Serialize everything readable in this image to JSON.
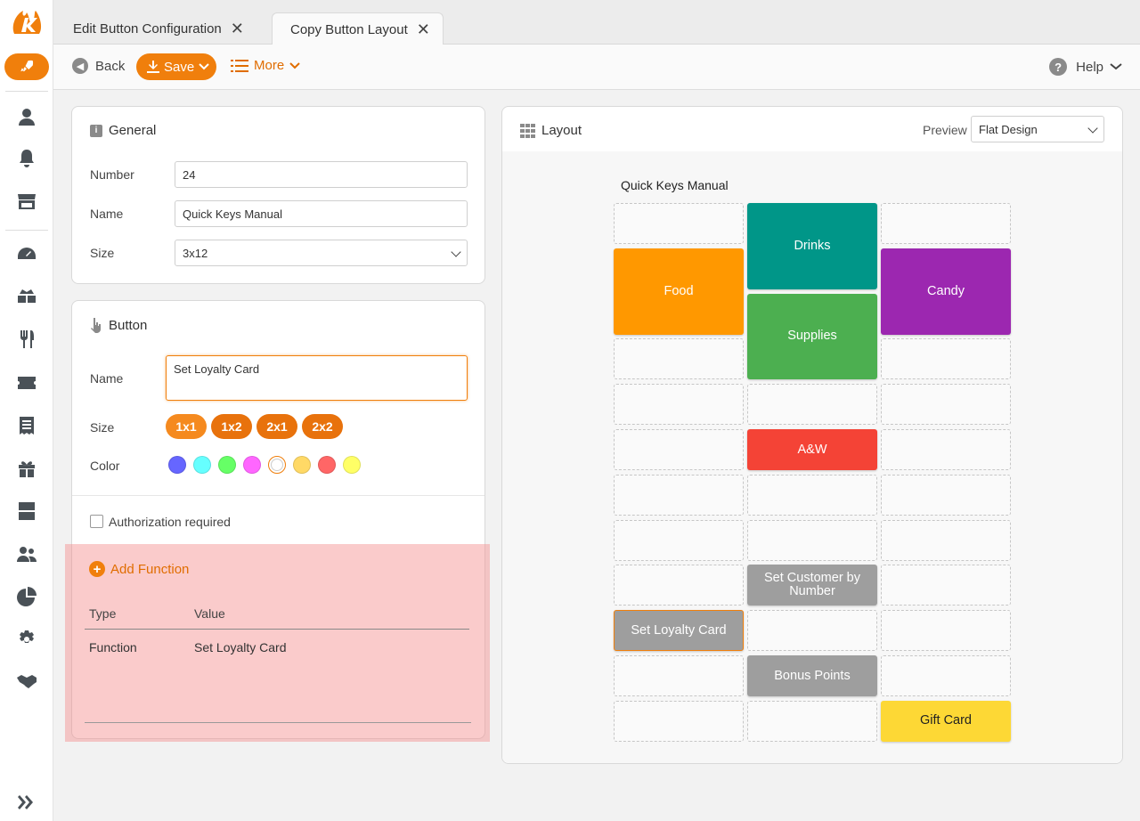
{
  "tabs": [
    {
      "label": "Edit Button Configuration"
    },
    {
      "label": "Copy Button Layout"
    }
  ],
  "toolbar": {
    "back": "Back",
    "save": "Save",
    "more": "More",
    "help": "Help"
  },
  "general": {
    "title": "General",
    "number_label": "Number",
    "number_value": "24",
    "name_label": "Name",
    "name_value": "Quick Keys Manual",
    "size_label": "Size",
    "size_value": "3x12"
  },
  "button": {
    "title": "Button",
    "name_label": "Name",
    "name_value": "Set Loyalty Card",
    "size_label": "Size",
    "sizes": [
      "1x1",
      "1x2",
      "2x1",
      "2x2"
    ],
    "color_label": "Color",
    "colors": [
      "#6666ff",
      "#66ffff",
      "#66ff66",
      "#ff66ff",
      "#ffffff",
      "#ffd966",
      "#ff6666",
      "#ffff66"
    ],
    "auth_label": "Authorization required",
    "add_function": "Add Function",
    "table_headers": [
      "Type",
      "Value"
    ],
    "rows": [
      {
        "type": "Function",
        "value": "Set Loyalty Card"
      }
    ]
  },
  "layout": {
    "title": "Layout",
    "preview_label": "Preview",
    "preview_value": "Flat Design",
    "grid_title": "Quick Keys Manual",
    "buttons": [
      {
        "label": "Drinks",
        "color": "#009688"
      },
      {
        "label": "Food",
        "color": "#ff9800"
      },
      {
        "label": "Candy",
        "color": "#9c27b0"
      },
      {
        "label": "Supplies",
        "color": "#4caf50"
      },
      {
        "label": "A&W",
        "color": "#f44336"
      },
      {
        "label": "Set Customer by Number",
        "color": "#9e9e9e"
      },
      {
        "label": "Set Loyalty Card",
        "color": "#9e9e9e"
      },
      {
        "label": "Bonus Points",
        "color": "#9e9e9e"
      },
      {
        "label": "Gift Card",
        "color": "#fdd835"
      }
    ]
  }
}
